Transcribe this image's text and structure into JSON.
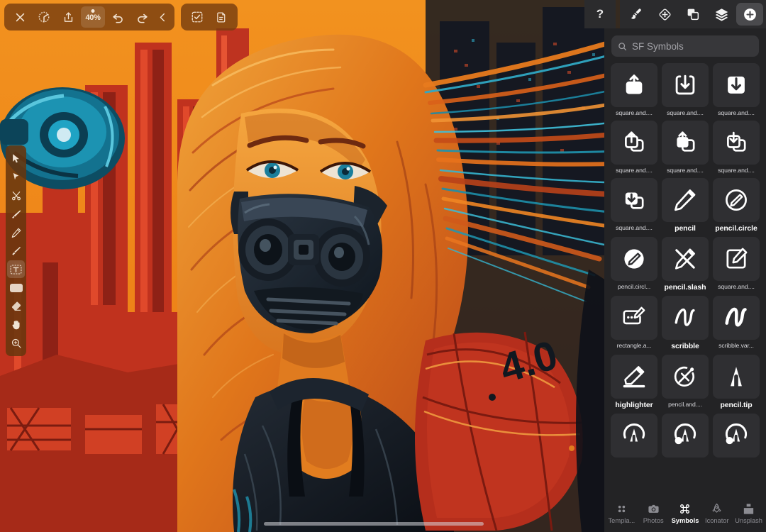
{
  "app": {
    "canvas_bg": "#E8891B",
    "accent_orange": "#F08A1E",
    "accent_red": "#C0291F",
    "accent_teal": "#1B7F96",
    "panel_bg": "#232325",
    "toolbar_bg": "#2b2b2d"
  },
  "top_left_toolbar": {
    "items": [
      {
        "name": "close-button",
        "icon": "close-icon",
        "label": "Close"
      },
      {
        "name": "settings-button",
        "icon": "gear-icon",
        "label": "Settings"
      },
      {
        "name": "share-button",
        "icon": "share-icon",
        "label": "Share"
      },
      {
        "name": "zoom-button",
        "icon": "zoom-level-icon",
        "label": "40%"
      },
      {
        "name": "undo-button",
        "icon": "undo-icon",
        "label": "Undo"
      },
      {
        "name": "redo-button",
        "icon": "redo-icon",
        "label": "Redo"
      },
      {
        "name": "back-button",
        "icon": "chevron-left-icon",
        "label": "Back"
      }
    ],
    "zoom_value": "40%",
    "second_group": [
      {
        "name": "select-all-button",
        "icon": "checkbox-dashed-icon",
        "label": "Select"
      },
      {
        "name": "duplicate-button",
        "icon": "copy-page-icon",
        "label": "Duplicate"
      }
    ]
  },
  "top_right_toolbar": {
    "help_label": "?",
    "items": [
      {
        "name": "brush-tool-button",
        "icon": "paintbrush-icon",
        "active": false
      },
      {
        "name": "transform-tool-button",
        "icon": "diamond-arrows-icon",
        "active": false
      },
      {
        "name": "shapes-tool-button",
        "icon": "overlapping-squares-icon",
        "active": false
      },
      {
        "name": "layers-button",
        "icon": "layers-stack-icon",
        "active": false
      },
      {
        "name": "add-button",
        "icon": "plus-circle-icon",
        "active": true
      }
    ]
  },
  "left_rail": {
    "items": [
      {
        "name": "tool-move",
        "icon": "cursor-arrow-icon",
        "selected": false
      },
      {
        "name": "tool-direct-select",
        "icon": "solid-arrow-icon",
        "selected": false
      },
      {
        "name": "tool-scissors",
        "icon": "scissors-icon",
        "selected": false
      },
      {
        "name": "tool-brush",
        "icon": "brush-icon",
        "selected": false
      },
      {
        "name": "tool-pencil",
        "icon": "pencil-icon",
        "selected": false
      },
      {
        "name": "tool-marker",
        "icon": "marker-icon",
        "selected": false
      },
      {
        "name": "tool-text",
        "icon": "text-box-icon",
        "selected": true
      },
      {
        "name": "tool-color-swatch",
        "icon": "color-swatch-icon",
        "selected": false
      },
      {
        "name": "tool-eraser",
        "icon": "eraser-icon",
        "selected": false
      },
      {
        "name": "tool-hand",
        "icon": "hand-icon",
        "selected": false
      },
      {
        "name": "tool-zoom",
        "icon": "magnifier-plus-icon",
        "selected": false
      }
    ]
  },
  "symbols_panel": {
    "search": {
      "placeholder": "SF Symbols",
      "value": "",
      "icon": "search-icon"
    },
    "symbols": [
      {
        "name": "square.and.arrow.up.fill",
        "label": "square.and....",
        "glyph": "square-arrow-up-fill",
        "bold": false
      },
      {
        "name": "square.and.arrow.down",
        "label": "square.and....",
        "glyph": "square-arrow-down",
        "bold": false
      },
      {
        "name": "square.and.arrow.down.fill",
        "label": "square.and....",
        "glyph": "square-arrow-down-fill",
        "bold": false
      },
      {
        "name": "square.and.arrow.up.on.square",
        "label": "square.and....",
        "glyph": "square-arrow-up-on-square",
        "bold": false
      },
      {
        "name": "square.and.arrow.up.on.square.fill",
        "label": "square.and....",
        "glyph": "square-arrow-up-on-square-fill",
        "bold": false
      },
      {
        "name": "square.and.arrow.down.on.square",
        "label": "square.and....",
        "glyph": "square-arrow-down-on-square",
        "bold": false
      },
      {
        "name": "square.and.arrow.down.on.square.fill",
        "label": "square.and....",
        "glyph": "square-arrow-down-on-square-fill",
        "bold": false
      },
      {
        "name": "pencil",
        "label": "pencil",
        "glyph": "pencil",
        "bold": true
      },
      {
        "name": "pencil.circle",
        "label": "pencil.circle",
        "glyph": "pencil-circle",
        "bold": true
      },
      {
        "name": "pencil.circle.fill",
        "label": "pencil.circl...",
        "glyph": "pencil-circle-fill",
        "bold": false
      },
      {
        "name": "pencil.slash",
        "label": "pencil.slash",
        "glyph": "pencil-slash",
        "bold": true
      },
      {
        "name": "square.and.pencil",
        "label": "square.and....",
        "glyph": "square-and-pencil",
        "bold": false
      },
      {
        "name": "rectangle.and.pencil.and.ellipsis",
        "label": "rectangle.a...",
        "glyph": "rectangle-and-pencil",
        "bold": false
      },
      {
        "name": "scribble",
        "label": "scribble",
        "glyph": "scribble",
        "bold": true
      },
      {
        "name": "scribble.variable",
        "label": "scribble.var...",
        "glyph": "scribble-variable",
        "bold": false
      },
      {
        "name": "highlighter",
        "label": "highlighter",
        "glyph": "highlighter",
        "bold": true
      },
      {
        "name": "pencil.and.outline",
        "label": "pencil.and....",
        "glyph": "pencil-and-outline",
        "bold": false
      },
      {
        "name": "pencil.tip",
        "label": "pencil.tip",
        "glyph": "pencil-tip",
        "bold": true
      },
      {
        "name": "pencil.tip.crop.circle",
        "label": "",
        "glyph": "pencil-tip-crop-circle",
        "bold": false
      },
      {
        "name": "pencil.tip.crop.circle.badge.plus",
        "label": "",
        "glyph": "pencil-tip-crop-circle-plus",
        "bold": false
      },
      {
        "name": "pencil.tip.crop.circle.badge.minus",
        "label": "",
        "glyph": "pencil-tip-crop-circle-minus",
        "bold": false
      }
    ],
    "tabs": [
      {
        "name": "tab-templates",
        "label": "Templa...",
        "icon": "grid-dots-icon",
        "active": false
      },
      {
        "name": "tab-photos",
        "label": "Photos",
        "icon": "camera-icon",
        "active": false
      },
      {
        "name": "tab-symbols",
        "label": "Symbols",
        "icon": "command-icon",
        "active": true
      },
      {
        "name": "tab-iconator",
        "label": "Iconator",
        "icon": "rocket-icon",
        "active": false
      },
      {
        "name": "tab-unsplash",
        "label": "Unsplash",
        "icon": "unsplash-icon",
        "active": false
      }
    ]
  },
  "artwork": {
    "description": "Cyberpunk illustration of a woman with long flowing hair wearing a gas mask against an orange and red city skyline",
    "tattoo_text": "4.0"
  },
  "scrollbar": {
    "name": "horizontal-scrollbar"
  }
}
